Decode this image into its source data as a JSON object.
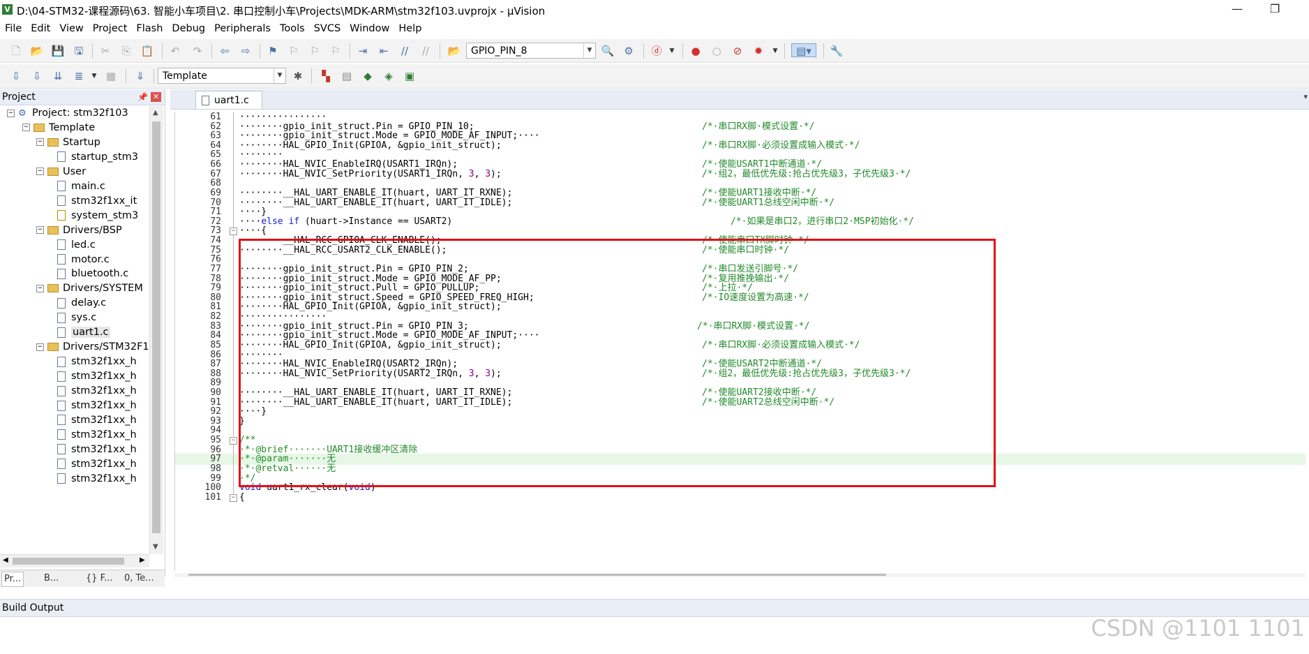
{
  "window": {
    "title": "D:\\04-STM32-课程源码\\63. 智能小车项目\\2. 串口控制小车\\Projects\\MDK-ARM\\stm32f103.uvprojx - µVision",
    "minimize": "—",
    "restore": "❐"
  },
  "menu": [
    "File",
    "Edit",
    "View",
    "Project",
    "Flash",
    "Debug",
    "Peripherals",
    "Tools",
    "SVCS",
    "Window",
    "Help"
  ],
  "toolbar": {
    "find_combo": "GPIO_PIN_8",
    "target_combo": "Template"
  },
  "project_pane": {
    "title": "Project",
    "pin_icon": "pin-icon",
    "tree": [
      {
        "label": "Project: stm32f103",
        "kind": "project",
        "indent": 0,
        "expander": "−"
      },
      {
        "label": "Template",
        "kind": "folder",
        "indent": 1,
        "expander": "−"
      },
      {
        "label": "Startup",
        "kind": "folder",
        "indent": 2,
        "expander": "−"
      },
      {
        "label": "startup_stm3",
        "kind": "file",
        "indent": 3
      },
      {
        "label": "User",
        "kind": "folder",
        "indent": 2,
        "expander": "−"
      },
      {
        "label": "main.c",
        "kind": "file",
        "indent": 3
      },
      {
        "label": "stm32f1xx_it",
        "kind": "file",
        "indent": 3
      },
      {
        "label": "system_stm3",
        "kind": "keyfile",
        "indent": 3
      },
      {
        "label": "Drivers/BSP",
        "kind": "folder",
        "indent": 2,
        "expander": "−"
      },
      {
        "label": "led.c",
        "kind": "file",
        "indent": 3
      },
      {
        "label": "motor.c",
        "kind": "file",
        "indent": 3
      },
      {
        "label": "bluetooth.c",
        "kind": "file",
        "indent": 3
      },
      {
        "label": "Drivers/SYSTEM",
        "kind": "folder",
        "indent": 2,
        "expander": "−"
      },
      {
        "label": "delay.c",
        "kind": "file",
        "indent": 3
      },
      {
        "label": "sys.c",
        "kind": "file",
        "indent": 3
      },
      {
        "label": "uart1.c",
        "kind": "file",
        "indent": 3,
        "selected": true
      },
      {
        "label": "Drivers/STM32F1",
        "kind": "folder",
        "indent": 2,
        "expander": "−"
      },
      {
        "label": "stm32f1xx_h",
        "kind": "file",
        "indent": 3
      },
      {
        "label": "stm32f1xx_h",
        "kind": "file",
        "indent": 3
      },
      {
        "label": "stm32f1xx_h",
        "kind": "file",
        "indent": 3
      },
      {
        "label": "stm32f1xx_h",
        "kind": "file",
        "indent": 3
      },
      {
        "label": "stm32f1xx_h",
        "kind": "file",
        "indent": 3
      },
      {
        "label": "stm32f1xx_h",
        "kind": "file",
        "indent": 3
      },
      {
        "label": "stm32f1xx_h",
        "kind": "file",
        "indent": 3
      },
      {
        "label": "stm32f1xx_h",
        "kind": "file",
        "indent": 3
      },
      {
        "label": "stm32f1xx_h",
        "kind": "file",
        "indent": 3
      }
    ],
    "tabs": [
      "Pr...",
      "B...",
      "{} F...",
      "0, Te..."
    ]
  },
  "editor": {
    "tab_label": "uart1.c",
    "lines": [
      {
        "n": "61",
        "code": "················",
        "comment": ""
      },
      {
        "n": "62",
        "code": "········gpio_init_struct.Pin = GPIO_PIN_10;",
        "comment": "/*·串口RX脚·模式设置·*/"
      },
      {
        "n": "63",
        "code": "········gpio_init_struct.Mode = GPIO_MODE_AF_INPUT;····",
        "comment": ""
      },
      {
        "n": "64",
        "code": "········HAL_GPIO_Init(GPIOA, &gpio_init_struct);",
        "comment": "/*·串口RX脚·必须设置成输入模式·*/"
      },
      {
        "n": "65",
        "code": "········",
        "comment": ""
      },
      {
        "n": "66",
        "code": "········HAL_NVIC_EnableIRQ(USART1_IRQn);",
        "comment": "/*·使能USART1中断通道·*/"
      },
      {
        "n": "67",
        "code": "········HAL_NVIC_SetPriority(USART1_IRQn, 3, 3);",
        "comment": "/*·组2，最低优先级:抢占优先级3，子优先级3·*/"
      },
      {
        "n": "68",
        "code": "",
        "comment": ""
      },
      {
        "n": "69",
        "code": "········__HAL_UART_ENABLE_IT(huart, UART_IT_RXNE);",
        "comment": "/*·使能UART1接收中断·*/"
      },
      {
        "n": "70",
        "code": "········__HAL_UART_ENABLE_IT(huart, UART_IT_IDLE);",
        "comment": "/*·使能UART1总线空闲中断·*/"
      },
      {
        "n": "71",
        "code": "····}",
        "comment": ""
      },
      {
        "n": "72",
        "code": "····else if (huart->Instance == USART2)",
        "comment": "/*·如果是串口2，进行串口2·MSP初始化·*/",
        "cindent": 1
      },
      {
        "n": "73",
        "code": "····{",
        "comment": "",
        "fold": "−"
      },
      {
        "n": "74",
        "code": "········__HAL_RCC_GPIOA_CLK_ENABLE();",
        "comment": "/*·使能串口TX脚时钟·*/"
      },
      {
        "n": "75",
        "code": "········__HAL_RCC_USART2_CLK_ENABLE();",
        "comment": "/*·使能串口时钟·*/"
      },
      {
        "n": "76",
        "code": "",
        "comment": ""
      },
      {
        "n": "77",
        "code": "········gpio_init_struct.Pin = GPIO_PIN_2;",
        "comment": "/*·串口发送引脚号·*/"
      },
      {
        "n": "78",
        "code": "········gpio_init_struct.Mode = GPIO_MODE_AF_PP;",
        "comment": "/*·复用推挽输出·*/"
      },
      {
        "n": "79",
        "code": "········gpio_init_struct.Pull = GPIO_PULLUP;",
        "comment": "/*·上拉·*/"
      },
      {
        "n": "80",
        "code": "········gpio_init_struct.Speed = GPIO_SPEED_FREQ_HIGH;",
        "comment": "/*·IO速度设置为高速·*/"
      },
      {
        "n": "81",
        "code": "········HAL_GPIO_Init(GPIOA, &gpio_init_struct);",
        "comment": ""
      },
      {
        "n": "82",
        "code": "················",
        "comment": ""
      },
      {
        "n": "83",
        "code": "········gpio_init_struct.Pin = GPIO_PIN_3;",
        "comment": "/*·串口RX脚·模式设置·*/",
        "cindent": 2
      },
      {
        "n": "84",
        "code": "········gpio_init_struct.Mode = GPIO_MODE_AF_INPUT;····",
        "comment": ""
      },
      {
        "n": "85",
        "code": "········HAL_GPIO_Init(GPIOA, &gpio_init_struct);",
        "comment": "/*·串口RX脚·必须设置成输入模式·*/"
      },
      {
        "n": "86",
        "code": "········",
        "comment": ""
      },
      {
        "n": "87",
        "code": "········HAL_NVIC_EnableIRQ(USART2_IRQn);",
        "comment": "/*·使能USART2中断通道·*/"
      },
      {
        "n": "88",
        "code": "········HAL_NVIC_SetPriority(USART2_IRQn, 3, 3);",
        "comment": "/*·组2，最低优先级:抢占优先级3，子优先级3·*/"
      },
      {
        "n": "89",
        "code": "",
        "comment": ""
      },
      {
        "n": "90",
        "code": "········__HAL_UART_ENABLE_IT(huart, UART_IT_RXNE);",
        "comment": "/*·使能UART2接收中断·*/"
      },
      {
        "n": "91",
        "code": "········__HAL_UART_ENABLE_IT(huart, UART_IT_IDLE);",
        "comment": "/*·使能UART2总线空闲中断·*/"
      },
      {
        "n": "92",
        "code": "····}",
        "comment": ""
      },
      {
        "n": "93",
        "code": "}",
        "comment": ""
      },
      {
        "n": "94",
        "code": "",
        "comment": ""
      },
      {
        "n": "95",
        "code": "/**",
        "comment": "",
        "fold": "−",
        "is_comment": true
      },
      {
        "n": "96",
        "code": "·*·@brief·······UART1接收缓冲区清除",
        "comment": "",
        "is_comment": true
      },
      {
        "n": "97",
        "code": "·*·@param·······无",
        "comment": "",
        "is_comment": true,
        "current": true
      },
      {
        "n": "98",
        "code": "·*·@retval······无",
        "comment": "",
        "is_comment": true
      },
      {
        "n": "99",
        "code": "·*/",
        "comment": "",
        "is_comment": true
      },
      {
        "n": "100",
        "code": "void uart1_rx_clear(void)",
        "comment": ""
      },
      {
        "n": "101",
        "code": "{",
        "comment": "",
        "fold": "−"
      }
    ]
  },
  "build_output": {
    "title": "Build Output"
  },
  "watermark": "CSDN @1101 1101",
  "colors": {
    "highlight_box": "#e0101a",
    "comment": "#218a2a",
    "keyword": "#1a1acc"
  }
}
